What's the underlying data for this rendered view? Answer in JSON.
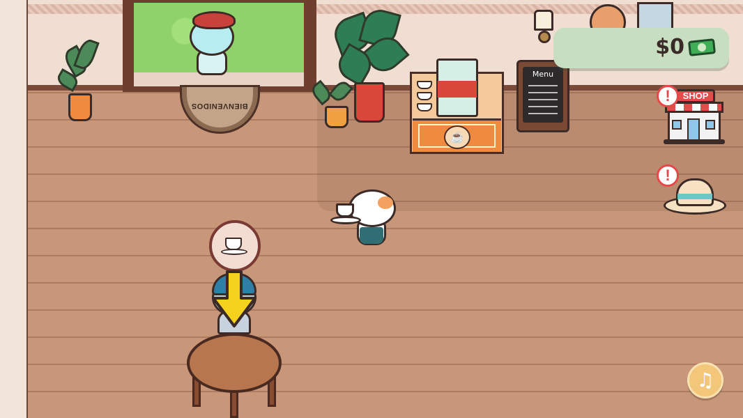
{
  "hud": {
    "money": "$0",
    "money_icon": "cash-icon"
  },
  "doormat": {
    "text": "BIENVENIDOS"
  },
  "menu_board": {
    "title": "Menu"
  },
  "shop": {
    "label": "SHOP",
    "alert": "!"
  },
  "hat_shop": {
    "alert": "!"
  },
  "order_bubble": {
    "item_icon": "coffee-cup-icon"
  },
  "music_button": {
    "glyph": "♫"
  },
  "colors": {
    "floor": "#c8977a",
    "money_panel": "#c7dec0",
    "alert_red": "#e54848",
    "arrow_yellow": "#f5d21e"
  }
}
